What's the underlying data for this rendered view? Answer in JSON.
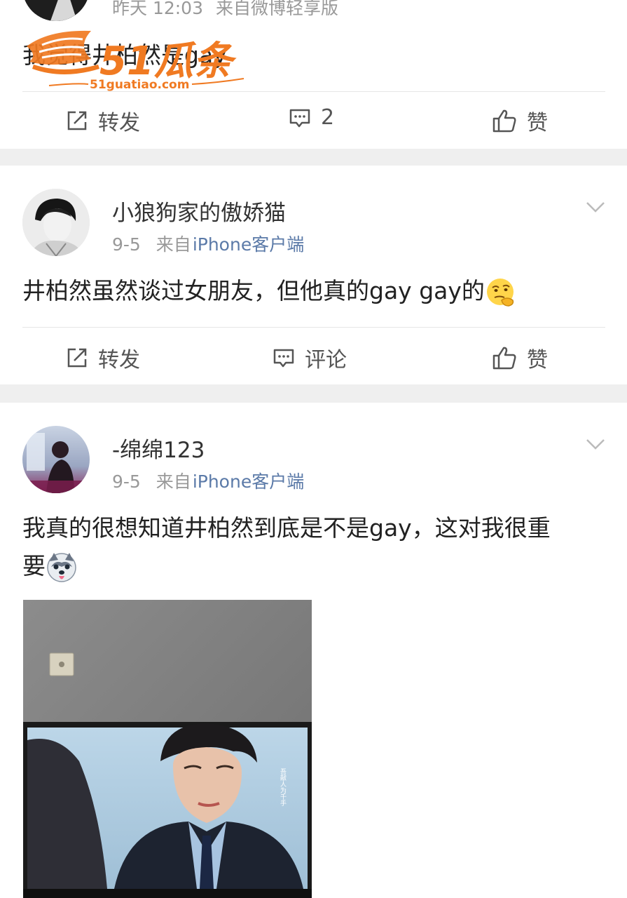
{
  "post1": {
    "meta_time": "昨天 12:03",
    "meta_source": "来自微博轻享版",
    "content_partial": "我觉得井柏然是gay",
    "actions": {
      "repost": "转发",
      "comment_count": "2",
      "like": "赞"
    }
  },
  "watermark": {
    "brand": "51瓜条",
    "url": "51guatiao.com",
    "color": "#f07a22"
  },
  "post2": {
    "username": "小狼狗家的傲娇猫",
    "time": "9-5",
    "source_prefix": "来自",
    "source_device": "iPhone客户端",
    "content": "井柏然虽然谈过女朋友，但他真的gay gay的",
    "emoji_icon": "thinking-face-icon",
    "actions": {
      "repost": "转发",
      "comment": "评论",
      "like": "赞"
    }
  },
  "post3": {
    "username": "-绵绵123",
    "time": "9-5",
    "source_prefix": "来自",
    "source_device": "iPhone客户端",
    "content_line1": "我真的很想知道井柏然到底是不是gay，这对我很重",
    "content_line2": "要",
    "emoji_icon": "husky-face-icon",
    "image_caption": "吾献人为千手"
  },
  "colors": {
    "link": "#5b7aa8",
    "meta": "#999999",
    "separator": "#efefef"
  }
}
